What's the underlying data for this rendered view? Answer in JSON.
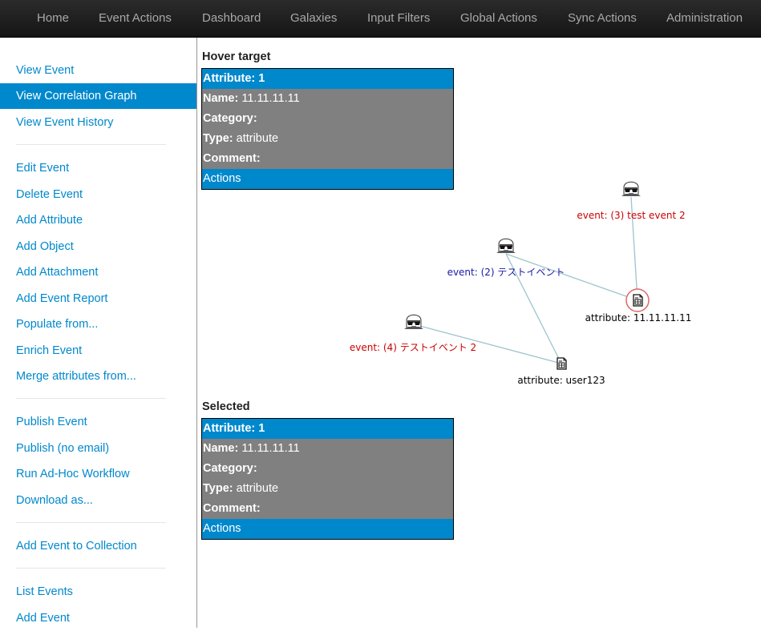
{
  "nav": {
    "items": [
      "Home",
      "Event Actions",
      "Dashboard",
      "Galaxies",
      "Input Filters",
      "Global Actions",
      "Sync Actions",
      "Administration"
    ]
  },
  "sidebar": {
    "items": [
      "View Event",
      "View Correlation Graph",
      "View Event History",
      "Edit Event",
      "Delete Event",
      "Add Attribute",
      "Add Object",
      "Add Attachment",
      "Add Event Report",
      "Populate from...",
      "Enrich Event",
      "Merge attributes from...",
      "Publish Event",
      "Publish (no email)",
      "Run Ad-Hoc Workflow",
      "Download as...",
      "Add Event to Collection",
      "List Events",
      "Add Event"
    ],
    "active": "View Correlation Graph"
  },
  "hover": {
    "title": "Hover target",
    "attribute_key": "Attribute:",
    "attribute_val": "1",
    "name_key": "Name:",
    "name_val": "11.11.11.11",
    "category_key": "Category:",
    "category_val": "",
    "type_key": "Type:",
    "type_val": "attribute",
    "comment_key": "Comment:",
    "comment_val": "",
    "actions": "Actions"
  },
  "selected": {
    "title": "Selected",
    "attribute_key": "Attribute:",
    "attribute_val": "1",
    "name_key": "Name:",
    "name_val": "11.11.11.11",
    "category_key": "Category:",
    "category_val": "",
    "type_key": "Type:",
    "type_val": "attribute",
    "comment_key": "Comment:",
    "comment_val": "",
    "actions": "Actions"
  },
  "graph": {
    "nodes": {
      "event3": {
        "label": "event: (3) test event 2"
      },
      "event2": {
        "label": "event: (2) テストイベント"
      },
      "attr1": {
        "label": "attribute: 11.11.11.11"
      },
      "event4": {
        "label": "event: (4) テストイベント 2"
      },
      "attr2": {
        "label": "attribute: user123"
      }
    },
    "colors": {
      "link": "#9cc5cc",
      "event_red": "#cc0000",
      "event_blue": "#1a1aa6",
      "attribute": "#000000",
      "selected_ring": "#e06666"
    }
  }
}
